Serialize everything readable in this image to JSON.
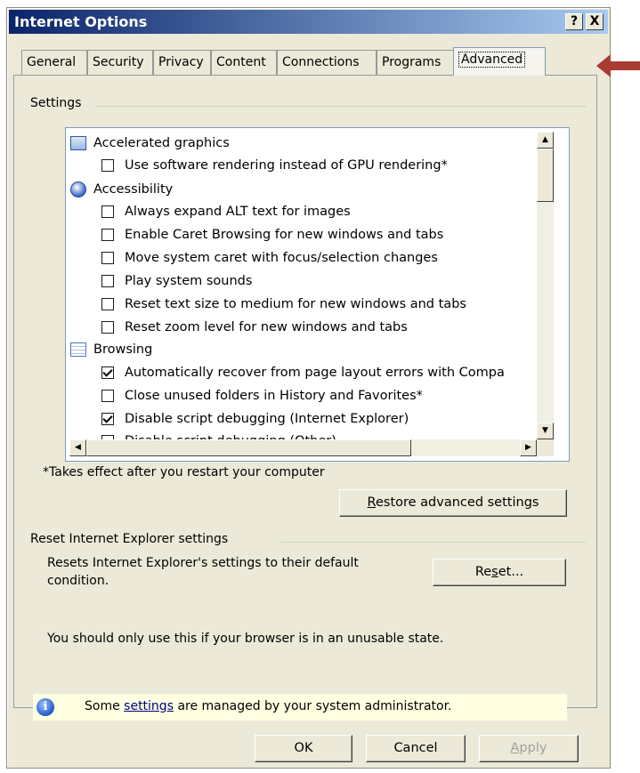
{
  "window": {
    "title": "Internet Options",
    "help_glyph": "?",
    "close_glyph": "X"
  },
  "tabs": [
    {
      "label": "General"
    },
    {
      "label": "Security"
    },
    {
      "label": "Privacy"
    },
    {
      "label": "Content"
    },
    {
      "label": "Connections"
    },
    {
      "label": "Programs"
    },
    {
      "label": "Advanced",
      "active": true
    }
  ],
  "settings": {
    "group_label": "Settings",
    "items": [
      {
        "type": "category",
        "icon": "graphics-icon",
        "label": "Accelerated graphics"
      },
      {
        "type": "checkbox",
        "checked": false,
        "label": "Use software rendering instead of GPU rendering*"
      },
      {
        "type": "category",
        "icon": "accessibility-icon",
        "label": "Accessibility"
      },
      {
        "type": "checkbox",
        "checked": false,
        "label": "Always expand ALT text for images"
      },
      {
        "type": "checkbox",
        "checked": false,
        "label": "Enable Caret Browsing for new windows and tabs"
      },
      {
        "type": "checkbox",
        "checked": false,
        "label": "Move system caret with focus/selection changes"
      },
      {
        "type": "checkbox",
        "checked": false,
        "label": "Play system sounds"
      },
      {
        "type": "checkbox",
        "checked": false,
        "label": "Reset text size to medium for new windows and tabs"
      },
      {
        "type": "checkbox",
        "checked": false,
        "label": "Reset zoom level for new windows and tabs"
      },
      {
        "type": "category",
        "icon": "browsing-icon",
        "label": "Browsing"
      },
      {
        "type": "checkbox",
        "checked": true,
        "label": "Automatically recover from page layout errors with Compa"
      },
      {
        "type": "checkbox",
        "checked": false,
        "label": "Close unused folders in History and Favorites*"
      },
      {
        "type": "checkbox",
        "checked": true,
        "label": "Disable script debugging (Internet Explorer)"
      },
      {
        "type": "checkbox",
        "checked": false,
        "label": "Disable script debugging (Other)"
      }
    ],
    "restart_note": "*Takes effect after you restart your computer",
    "restore_button": {
      "before": "",
      "accel": "R",
      "after": "estore advanced settings"
    }
  },
  "reset": {
    "group_label": "Reset Internet Explorer settings",
    "description": "Resets Internet Explorer's settings to their default condition.",
    "warning": "You should only use this if your browser is in an unusable state.",
    "reset_button": {
      "before": "Re",
      "accel": "s",
      "after": "et..."
    }
  },
  "info_bar": {
    "prefix": "Some ",
    "link": "settings",
    "suffix": " are managed by your system administrator."
  },
  "footer": {
    "ok": "OK",
    "cancel": "Cancel",
    "apply": {
      "before": "",
      "accel": "A",
      "after": "pply"
    }
  },
  "colors": {
    "title_gradient_start": "#0a246a",
    "title_gradient_end": "#a6caf0",
    "dialog_face": "#ece9d8",
    "arrow_annotation": "#a93b33",
    "info_background": "#ffffe1"
  }
}
